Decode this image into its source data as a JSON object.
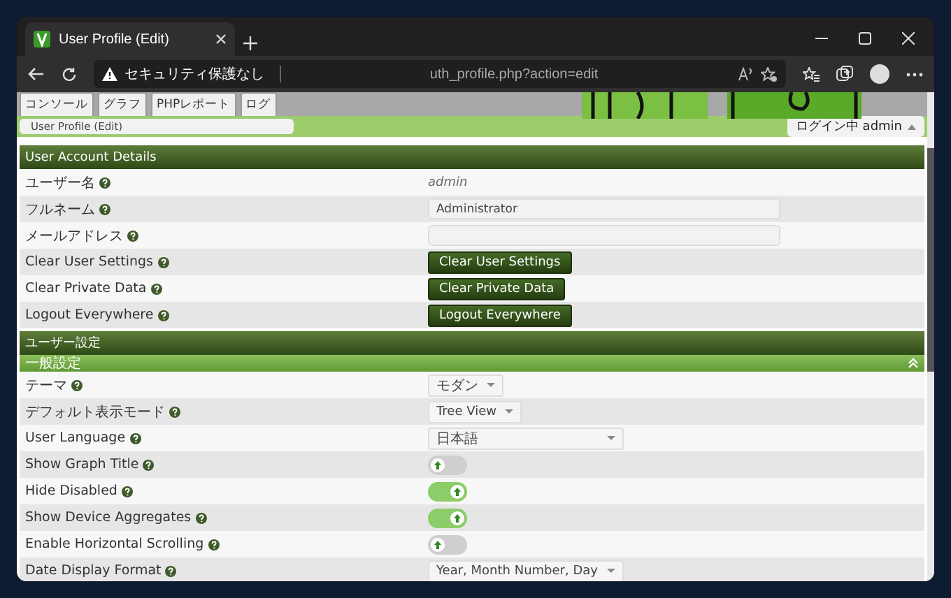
{
  "browser": {
    "tab_title": "User Profile (Edit)",
    "security_label": "セキュリティ保護なし",
    "url": "uth_profile.php?action=edit"
  },
  "nav_tabs": [
    {
      "label": "コンソール",
      "selected": false
    },
    {
      "label": "グラフ",
      "selected": false
    },
    {
      "label": "PHPレポート",
      "selected": false
    },
    {
      "label": "ログ",
      "selected": false
    }
  ],
  "breadcrumb": "User Profile (Edit)",
  "login_label": "ログイン中 admin",
  "account_section": {
    "title": "User Account Details",
    "rows": [
      {
        "label": "ユーザー名",
        "kind": "text",
        "value": "admin"
      },
      {
        "label": "フルネーム",
        "kind": "input",
        "value": "Administrator"
      },
      {
        "label": "メールアドレス",
        "kind": "input",
        "value": ""
      },
      {
        "label": "Clear User Settings",
        "kind": "button",
        "value": "Clear User Settings"
      },
      {
        "label": "Clear Private Data",
        "kind": "button",
        "value": "Clear Private Data"
      },
      {
        "label": "Logout Everywhere",
        "kind": "button",
        "value": "Logout Everywhere"
      }
    ]
  },
  "settings_section": {
    "title": "ユーザー設定",
    "subsection": {
      "title": "一般設定",
      "expanded": true,
      "rows": [
        {
          "label": "テーマ",
          "kind": "select",
          "value": "モダン"
        },
        {
          "label": "デフォルト表示モード",
          "kind": "select",
          "value": "Tree View"
        },
        {
          "label": "User Language",
          "kind": "wide_select",
          "value": "日本語"
        },
        {
          "label": "Show Graph Title",
          "kind": "toggle",
          "on": false
        },
        {
          "label": "Hide Disabled",
          "kind": "toggle",
          "on": true
        },
        {
          "label": "Show Device Aggregates",
          "kind": "toggle",
          "on": true
        },
        {
          "label": "Enable Horizontal Scrolling",
          "kind": "toggle",
          "on": false
        },
        {
          "label": "Date Display Format",
          "kind": "select",
          "value": "Year, Month Number, Day"
        }
      ]
    }
  }
}
